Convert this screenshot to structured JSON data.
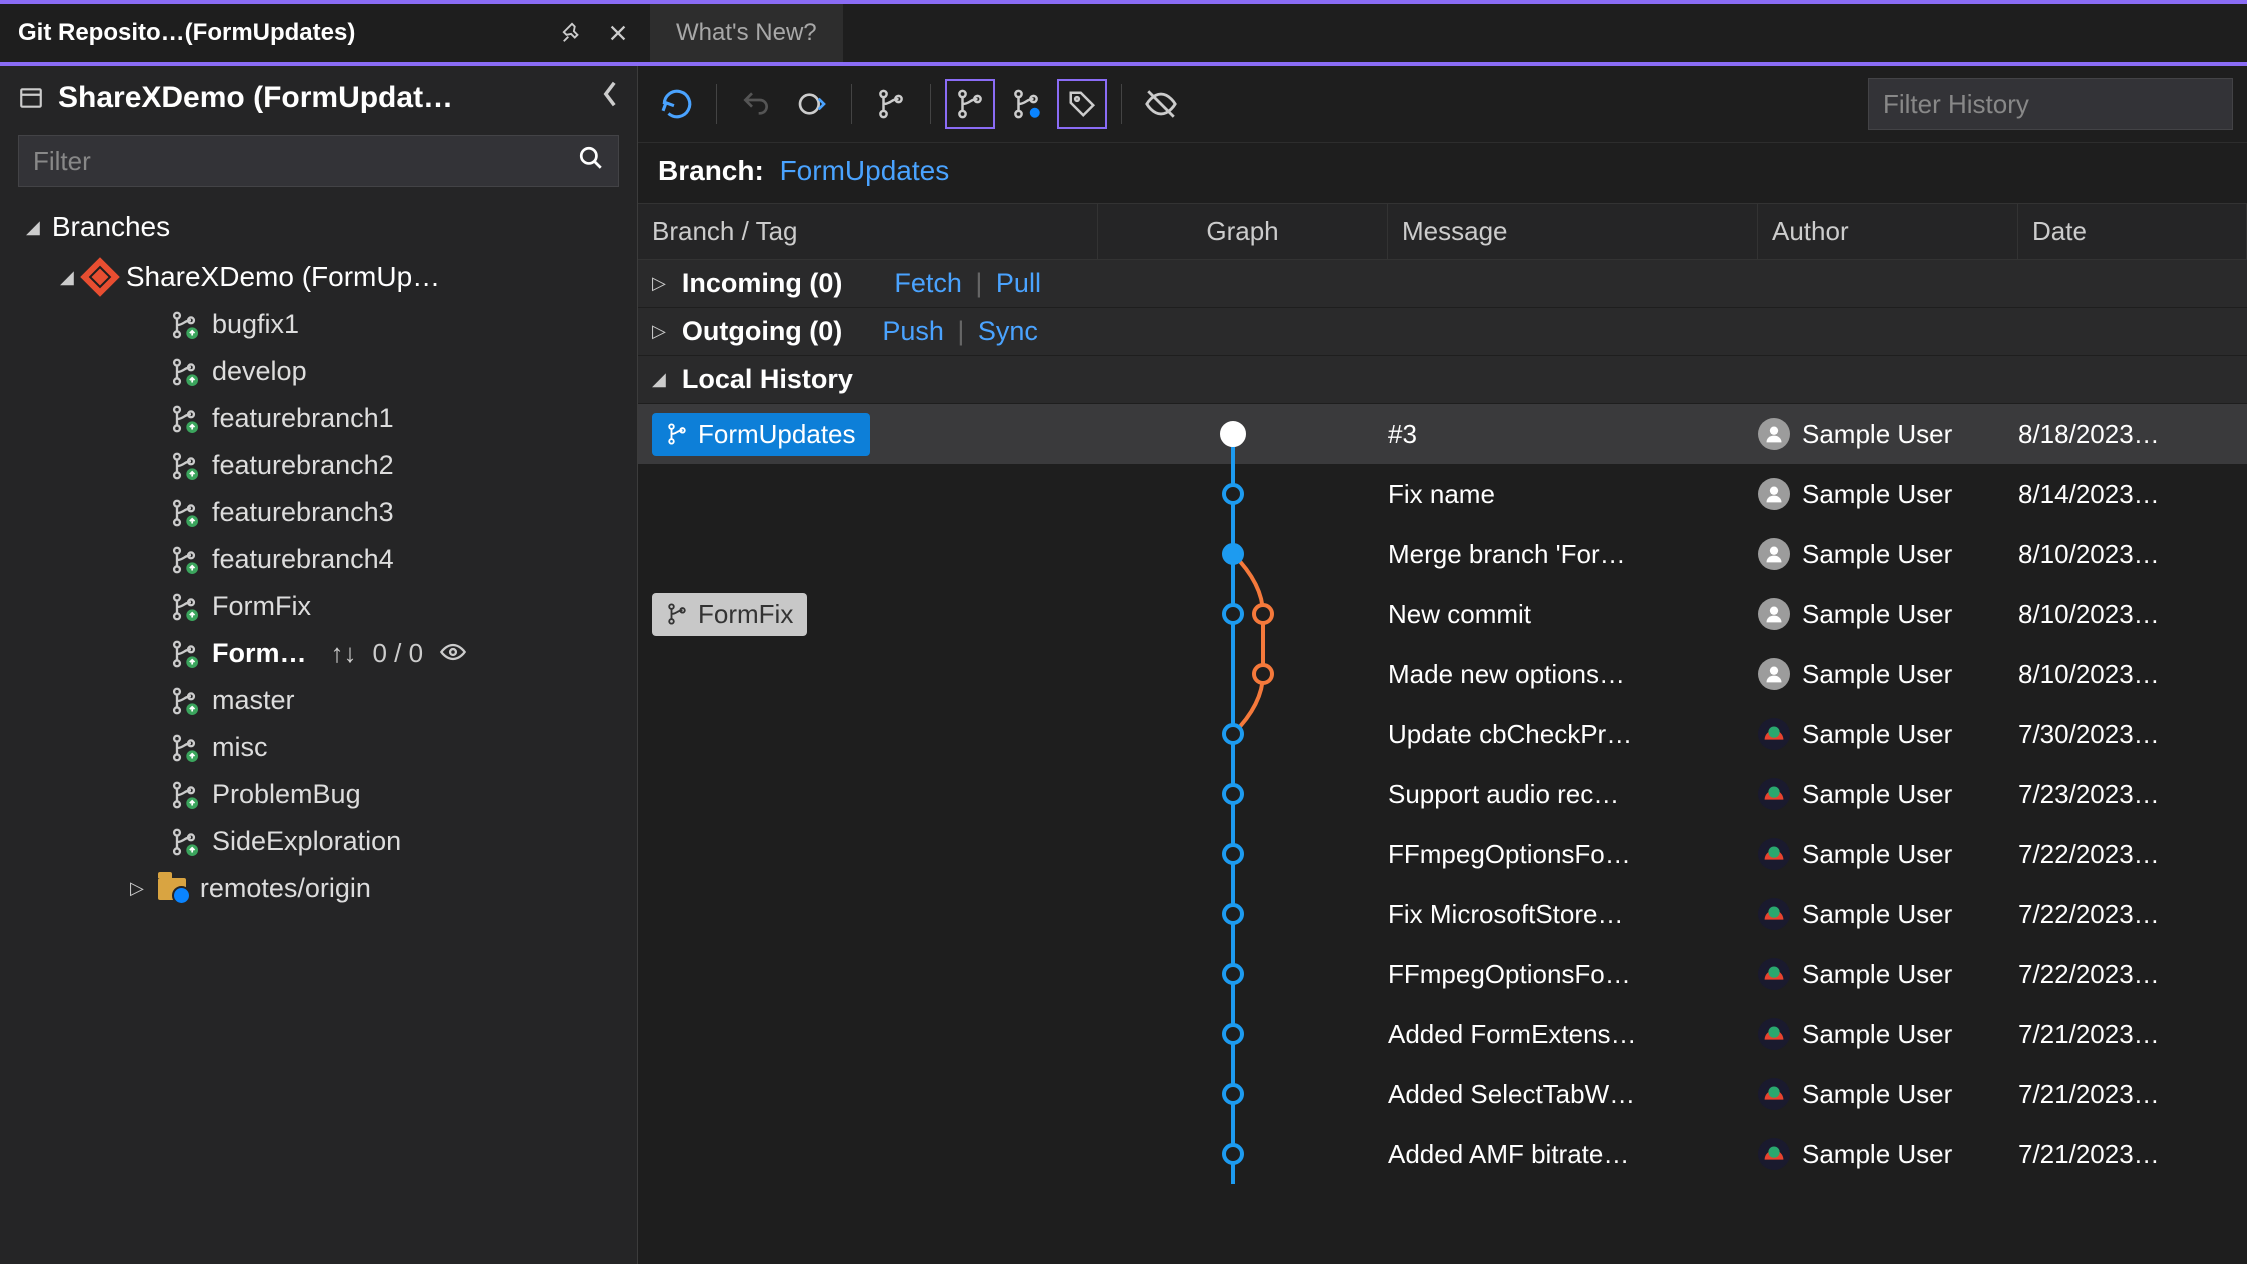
{
  "tabs": {
    "active_title": "Git Reposito…(FormUpdates)",
    "inactive_title": "What's New?"
  },
  "sidebar": {
    "repo_title": "ShareXDemo (FormUpdat…",
    "filter_placeholder": "Filter",
    "branches_header": "Branches",
    "repo_node": "ShareXDemo (FormUp…",
    "remotes_label": "remotes/origin",
    "branches": [
      {
        "name": "bugfix1",
        "current": false
      },
      {
        "name": "develop",
        "current": false
      },
      {
        "name": "featurebranch1",
        "current": false
      },
      {
        "name": "featurebranch2",
        "current": false
      },
      {
        "name": "featurebranch3",
        "current": false
      },
      {
        "name": "featurebranch4",
        "current": false
      },
      {
        "name": "FormFix",
        "current": false
      },
      {
        "name": "Form…",
        "current": true,
        "counts": "0 / 0"
      },
      {
        "name": "master",
        "current": false
      },
      {
        "name": "misc",
        "current": false
      },
      {
        "name": "ProblemBug",
        "current": false
      },
      {
        "name": "SideExploration",
        "current": false
      }
    ]
  },
  "toolbar": {
    "filter_history_placeholder": "Filter History"
  },
  "branch_label_prefix": "Branch:",
  "branch_name": "FormUpdates",
  "columns": {
    "branch": "Branch / Tag",
    "graph": "Graph",
    "message": "Message",
    "author": "Author",
    "date": "Date"
  },
  "sections": {
    "incoming_label": "Incoming (0)",
    "incoming_links": [
      "Fetch",
      "Pull"
    ],
    "outgoing_label": "Outgoing (0)",
    "outgoing_links": [
      "Push",
      "Sync"
    ],
    "local_history": "Local History"
  },
  "commits": [
    {
      "tag": "FormUpdates",
      "tag_style": "current",
      "msg": "#3",
      "author": "Sample User",
      "avatar": "gray",
      "date": "8/18/2023…",
      "selected": true
    },
    {
      "tag": "",
      "msg": "Fix name",
      "author": "Sample User",
      "avatar": "gray",
      "date": "8/14/2023…"
    },
    {
      "tag": "",
      "msg": "Merge branch 'For…",
      "author": "Sample User",
      "avatar": "gray",
      "date": "8/10/2023…"
    },
    {
      "tag": "FormFix",
      "tag_style": "gray",
      "msg": "New commit",
      "author": "Sample User",
      "avatar": "gray",
      "date": "8/10/2023…"
    },
    {
      "tag": "",
      "msg": "Made new options…",
      "author": "Sample User",
      "avatar": "gray",
      "date": "8/10/2023…"
    },
    {
      "tag": "",
      "msg": "Update cbCheckPr…",
      "author": "Sample User",
      "avatar": "alt",
      "date": "7/30/2023…"
    },
    {
      "tag": "",
      "msg": "Support audio rec…",
      "author": "Sample User",
      "avatar": "alt",
      "date": "7/23/2023…"
    },
    {
      "tag": "",
      "msg": "FFmpegOptionsFo…",
      "author": "Sample User",
      "avatar": "alt",
      "date": "7/22/2023…"
    },
    {
      "tag": "",
      "msg": "Fix MicrosoftStore…",
      "author": "Sample User",
      "avatar": "alt",
      "date": "7/22/2023…"
    },
    {
      "tag": "",
      "msg": "FFmpegOptionsFo…",
      "author": "Sample User",
      "avatar": "alt",
      "date": "7/22/2023…"
    },
    {
      "tag": "",
      "msg": "Added FormExtens…",
      "author": "Sample User",
      "avatar": "alt",
      "date": "7/21/2023…"
    },
    {
      "tag": "",
      "msg": "Added SelectTabW…",
      "author": "Sample User",
      "avatar": "alt",
      "date": "7/21/2023…"
    },
    {
      "tag": "",
      "msg": "Added AMF bitrate…",
      "author": "Sample User",
      "avatar": "alt",
      "date": "7/21/2023…"
    }
  ]
}
